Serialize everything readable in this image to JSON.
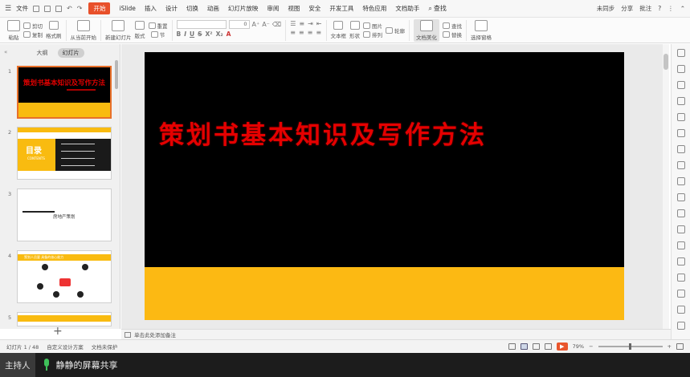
{
  "menubar": {
    "file_label": "文件",
    "tabs": [
      "开始",
      "iSlide",
      "插入",
      "设计",
      "切换",
      "动画",
      "幻灯片放映",
      "审阅",
      "视图",
      "安全",
      "开发工具",
      "特色应用",
      "文档助手"
    ],
    "search_label": "查找",
    "sync_label": "未同步",
    "share_label": "分享",
    "comment_label": "批注"
  },
  "ribbon": {
    "paste": "粘贴",
    "cut": "剪切",
    "copy": "复制",
    "format_painter": "格式刷",
    "from_current": "从当前开始",
    "new_slide": "新建幻灯片",
    "layout": "版式",
    "section": "节",
    "reset": "重置",
    "font_size": "0",
    "text_box": "文本框",
    "shape": "形状",
    "arrange": "排列",
    "image": "图片",
    "outline": "轮廓",
    "doc_beautify": "文档美化",
    "find": "查找",
    "replace": "替换",
    "select_pane": "选择窗格"
  },
  "left_panel": {
    "tab_outline": "大纲",
    "tab_slides": "幻灯片",
    "thumbs": [
      {
        "num": "1",
        "title": "策划书基本知识及写作方法"
      },
      {
        "num": "2",
        "title": "目录",
        "subtitle": "CONTENTS"
      },
      {
        "num": "3",
        "title": "房地产策划"
      },
      {
        "num": "4",
        "title": "策划人员要 具备的核心能力"
      },
      {
        "num": "5",
        "title": ""
      }
    ]
  },
  "slide": {
    "title": "策划书基本知识及写作方法"
  },
  "notes": {
    "placeholder": "单击此处添加备注"
  },
  "statusbar": {
    "slide_count": "幻灯片 1 / 48",
    "theme": "自定义设计方案",
    "protection": "文档未保护",
    "zoom": "79%"
  },
  "hostbar": {
    "host_label": "主持人",
    "share_text": "静静的屏幕共享"
  },
  "colors": {
    "accent": "#e8502a",
    "title_red": "#e50000",
    "yellow": "#fcb913",
    "mic_green": "#3fc15a"
  }
}
